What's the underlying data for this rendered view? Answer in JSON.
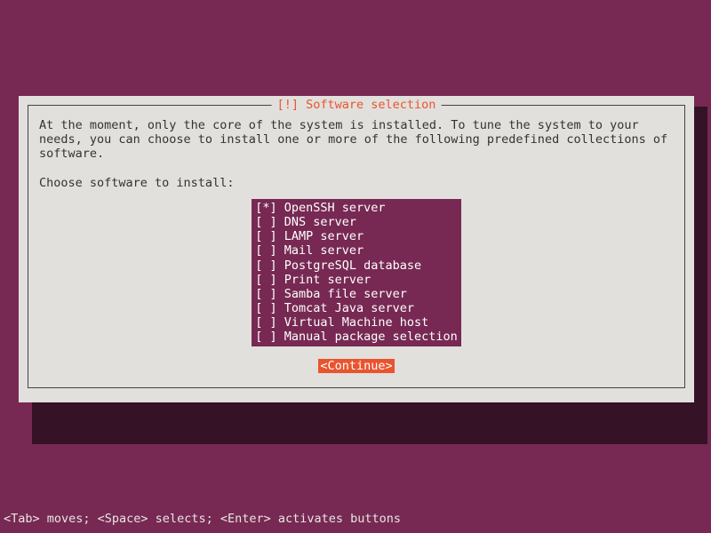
{
  "dialog": {
    "title": "[!] Software selection",
    "body": "At the moment, only the core of the system is installed. To tune the system to your needs, you can choose to install one or more of the following predefined collections of software.",
    "prompt": "Choose software to install:",
    "items": [
      {
        "checked": true,
        "label": "OpenSSH server"
      },
      {
        "checked": false,
        "label": "DNS server"
      },
      {
        "checked": false,
        "label": "LAMP server"
      },
      {
        "checked": false,
        "label": "Mail server"
      },
      {
        "checked": false,
        "label": "PostgreSQL database"
      },
      {
        "checked": false,
        "label": "Print server"
      },
      {
        "checked": false,
        "label": "Samba file server"
      },
      {
        "checked": false,
        "label": "Tomcat Java server"
      },
      {
        "checked": false,
        "label": "Virtual Machine host"
      },
      {
        "checked": false,
        "label": "Manual package selection"
      }
    ],
    "continue": "<Continue>"
  },
  "hint": "<Tab> moves; <Space> selects; <Enter> activates buttons"
}
